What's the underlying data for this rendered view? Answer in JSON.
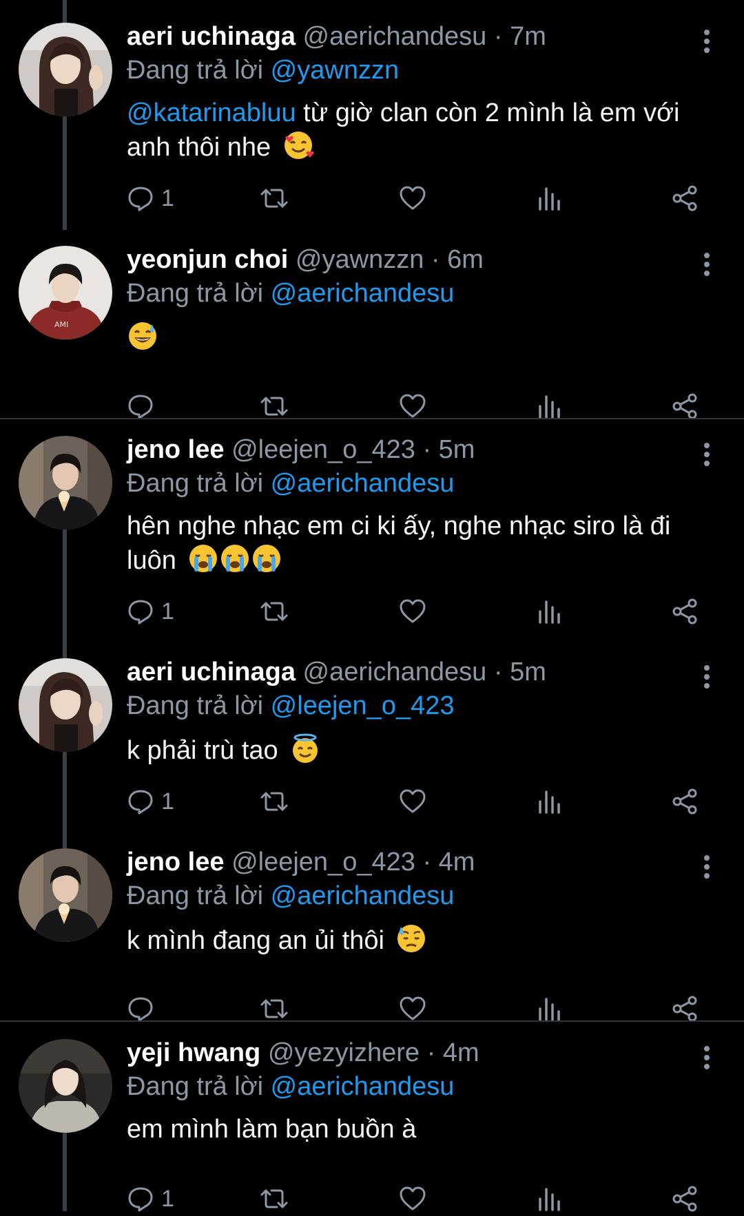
{
  "reply_prefix": "Đang trả lời",
  "tweets": [
    {
      "name": "aeri uchinaga",
      "handle": "@aerichandesu",
      "time": "7m",
      "reply_to": "@yawnzzn",
      "mention": "@katarinabluu",
      "text": " từ giờ clan còn 2 mình là em với anh thôi nhe",
      "emoji": "smiling-face-with-hearts",
      "reply_count": "1"
    },
    {
      "name": "yeonjun choi",
      "handle": "@yawnzzn",
      "time": "6m",
      "reply_to": "@aerichandesu",
      "mention": "",
      "text": "",
      "emoji": "grinning-sweat",
      "reply_count": ""
    },
    {
      "name": "jeno lee",
      "handle": "@leejen_o_423",
      "time": "5m",
      "reply_to": "@aerichandesu",
      "mention": "",
      "text": "hên nghe nhạc em ci ki ấy, nghe nhạc siro là đi luôn",
      "emoji": "loudly-crying-x3",
      "reply_count": "1"
    },
    {
      "name": "aeri uchinaga",
      "handle": "@aerichandesu",
      "time": "5m",
      "reply_to": "@leejen_o_423",
      "mention": "",
      "text": "k phải trù tao",
      "emoji": "smiling-halo",
      "reply_count": "1"
    },
    {
      "name": "jeno lee",
      "handle": "@leejen_o_423",
      "time": "4m",
      "reply_to": "@aerichandesu",
      "mention": "",
      "text": "k mình đang an ủi thôi",
      "emoji": "downcast-sweat",
      "reply_count": ""
    },
    {
      "name": "yeji hwang",
      "handle": "@yezyizhere",
      "time": "4m",
      "reply_to": "@aerichandesu",
      "mention": "",
      "text": "em mình làm bạn buồn à",
      "emoji": "",
      "reply_count": "1"
    }
  ],
  "colors": {
    "background": "#000000",
    "text": "#e7e9ea",
    "secondary": "#8b98a5",
    "link": "#1d9bf0",
    "divider": "#2f3336"
  }
}
